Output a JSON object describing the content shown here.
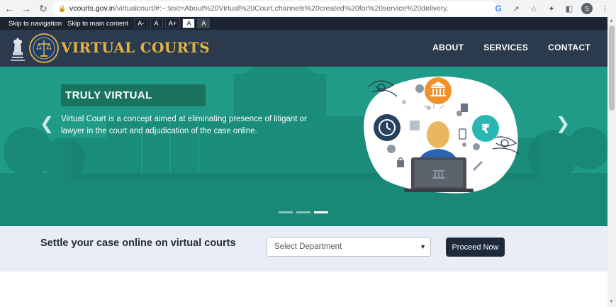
{
  "browser": {
    "url_domain": "vcourts.gov.in",
    "url_path": "/virtualcourt/#:~:text=About%20Virtual%20Court,channels%20created%20for%20service%20delivery.",
    "profile_initial": "S",
    "icons": [
      "back-icon",
      "forward-icon",
      "reload-icon",
      "lock-icon",
      "google-icon",
      "share-icon",
      "star-icon",
      "extensions-icon",
      "sidepanel-icon",
      "menu-icon"
    ]
  },
  "access_bar": {
    "skip_nav": "Skip to navigation",
    "skip_main": "Skip to main content",
    "font_small": "A-",
    "font_normal": "A",
    "font_large": "A+",
    "contrast_light": "A",
    "contrast_dark": "A"
  },
  "header": {
    "brand": "VIRTUAL COURTS",
    "nav": [
      "ABOUT",
      "SERVICES",
      "CONTACT"
    ],
    "brand_color": "#e3b341",
    "bg_color": "#2b3a4c"
  },
  "hero": {
    "title": "TRULY VIRTUAL",
    "text": "Virtual Court is a concept aimed at eliminating presence of litigant or lawyer in the court and adjudication of the case online.",
    "slides": 3,
    "active_slide": 3,
    "bg_color": "#1f9b87",
    "rupee_symbol": "₹"
  },
  "settle": {
    "text": "Settle your case online on virtual courts",
    "select_placeholder": "Select Department",
    "button": "Proceed Now"
  }
}
